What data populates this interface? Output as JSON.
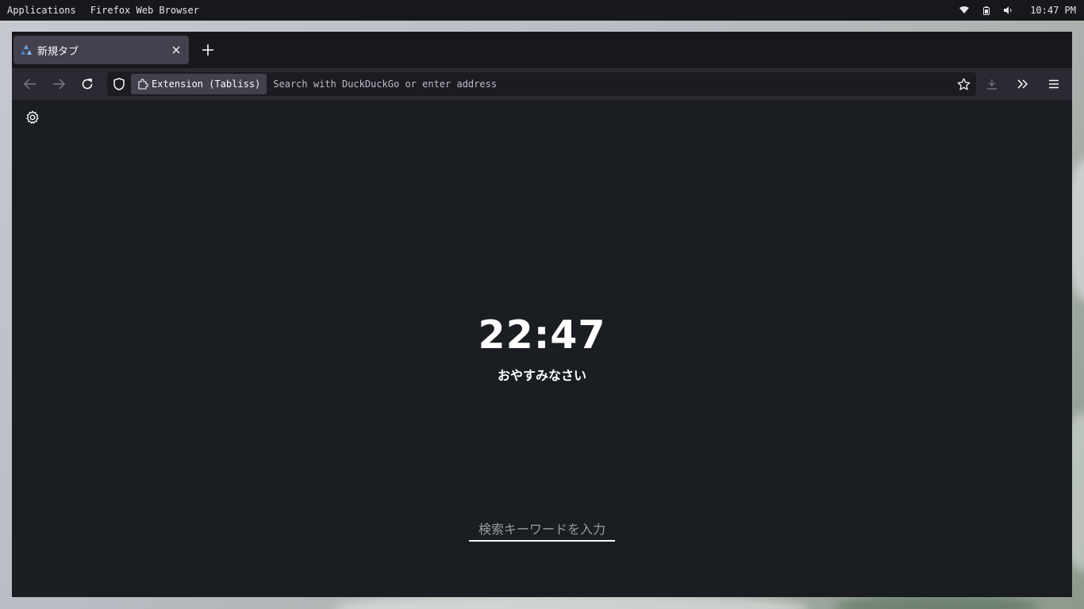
{
  "topbar": {
    "menu": [
      "Applications",
      "Firefox Web Browser"
    ],
    "clock": "10:47 PM",
    "tray_icons": [
      "wifi-icon",
      "battery-icon",
      "volume-icon"
    ]
  },
  "browser": {
    "tab": {
      "title": "新規タブ",
      "icon": "tabliss-icon"
    },
    "urlbar": {
      "extension_chip": "Extension (Tabliss)",
      "placeholder": "Search with DuckDuckGo or enter address"
    },
    "theme": {
      "tabstrip": "#17171c",
      "toolbar": "#2b2a33",
      "urlbar": "#1c1b22",
      "active_tab": "#42414d"
    }
  },
  "newtab": {
    "time": "22:47",
    "greeting": "おやすみなさい",
    "search_placeholder": "検索キーワードを入力",
    "background": "#1a1d22"
  }
}
